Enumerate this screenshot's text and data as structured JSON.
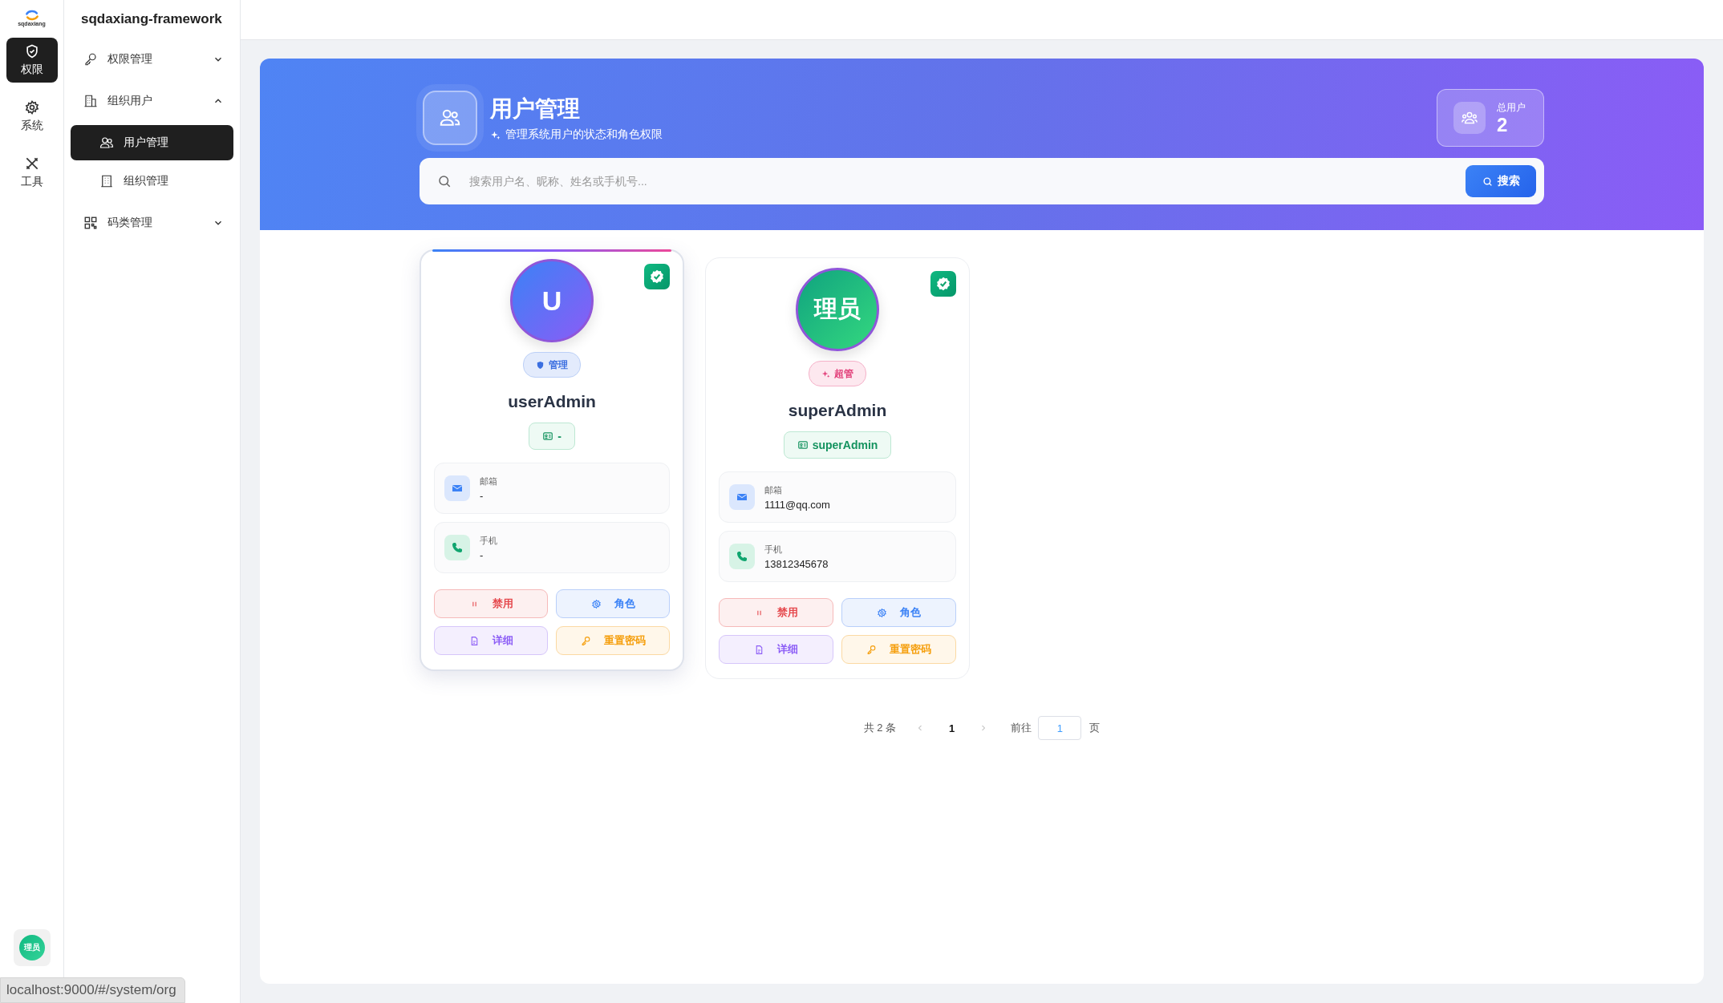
{
  "rail": {
    "logo_text": "sqdaxiang",
    "items": [
      {
        "label": "权限",
        "selected": true
      },
      {
        "label": "系统",
        "selected": false
      },
      {
        "label": "工具",
        "selected": false
      }
    ],
    "avatar_text": "理员"
  },
  "sidebar": {
    "title": "sqdaxiang-framework",
    "items": [
      {
        "label": "权限管理",
        "expanded": false
      },
      {
        "label": "组织用户",
        "expanded": true,
        "children": [
          {
            "label": "用户管理",
            "selected": true
          },
          {
            "label": "组织管理",
            "selected": false
          }
        ]
      },
      {
        "label": "码类管理",
        "expanded": false
      }
    ]
  },
  "header": {
    "title": "用户管理",
    "subtitle": "管理系统用户的状态和角色权限",
    "stat_label": "总用户",
    "stat_value": "2"
  },
  "search": {
    "placeholder": "搜索用户名、昵称、姓名或手机号...",
    "button": "搜索"
  },
  "users": [
    {
      "kind": "admin",
      "avatar": "U",
      "role": "管理",
      "name": "userAdmin",
      "account": "-",
      "verified": true,
      "highlighted": true,
      "fields": [
        {
          "kind": "email",
          "label": "邮箱",
          "value": "-"
        },
        {
          "kind": "phone",
          "label": "手机",
          "value": "-"
        }
      ],
      "actions": [
        {
          "kind": "disable",
          "label": "禁用"
        },
        {
          "kind": "role",
          "label": "角色"
        },
        {
          "kind": "detail",
          "label": "详细"
        },
        {
          "kind": "reset",
          "label": "重置密码"
        }
      ]
    },
    {
      "kind": "super",
      "avatar": "理员",
      "role": "超管",
      "name": "superAdmin",
      "account": "superAdmin",
      "verified": true,
      "highlighted": false,
      "fields": [
        {
          "kind": "email",
          "label": "邮箱",
          "value": "1111@qq.com"
        },
        {
          "kind": "phone",
          "label": "手机",
          "value": "13812345678"
        }
      ],
      "actions": [
        {
          "kind": "disable",
          "label": "禁用"
        },
        {
          "kind": "role",
          "label": "角色"
        },
        {
          "kind": "detail",
          "label": "详细"
        },
        {
          "kind": "reset",
          "label": "重置密码"
        }
      ]
    }
  ],
  "pagination": {
    "total": "共 2 条",
    "pages": [
      {
        "label": "1",
        "selected": true
      }
    ],
    "goto_label": "前往",
    "goto_value": "1",
    "page_suffix": "页"
  },
  "status_url": "localhost:9000/#/system/org"
}
